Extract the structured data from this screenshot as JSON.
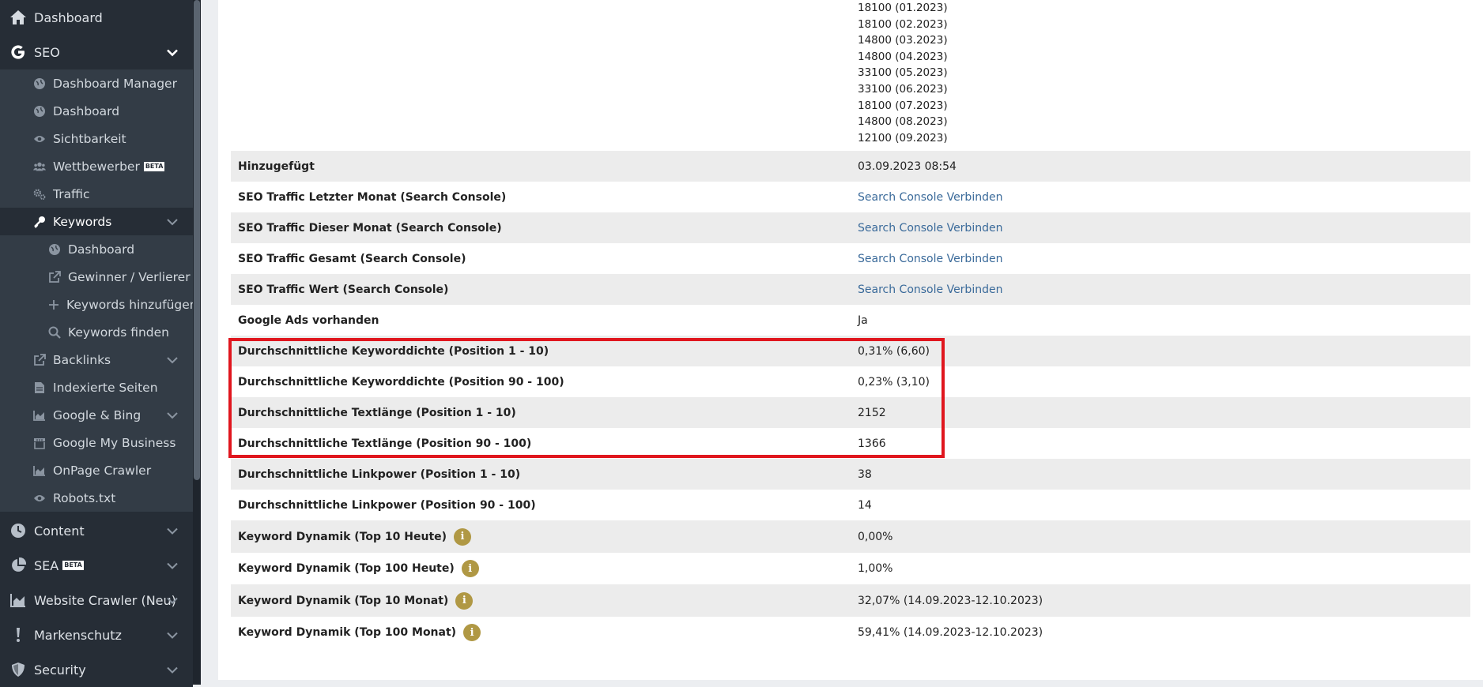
{
  "sidebar": {
    "dashboard": "Dashboard",
    "seo": "SEO",
    "seo_items": {
      "dashboard_manager": "Dashboard Manager",
      "dashboard": "Dashboard",
      "sichtbarkeit": "Sichtbarkeit",
      "wettbewerber": "Wettbewerber",
      "wettbewerber_badge": "BETA",
      "traffic": "Traffic",
      "keywords": "Keywords",
      "keywords_sub": {
        "dashboard": "Dashboard",
        "gewinner": "Gewinner / Verlierer",
        "hinzufuegen": "Keywords hinzufügen",
        "finden": "Keywords finden"
      },
      "backlinks": "Backlinks",
      "indexierte": "Indexierte Seiten",
      "google_bing": "Google & Bing",
      "gmb": "Google My Business",
      "onpage": "OnPage Crawler",
      "robots": "Robots.txt"
    },
    "content": "Content",
    "sea": "SEA",
    "sea_badge": "BETA",
    "website_crawler": "Website Crawler (Neu)",
    "markenschutz": "Markenschutz",
    "security": "Security"
  },
  "volumes": [
    "18100 (01.2023)",
    "18100 (02.2023)",
    "14800 (03.2023)",
    "14800 (04.2023)",
    "33100 (05.2023)",
    "33100 (06.2023)",
    "18100 (07.2023)",
    "14800 (08.2023)",
    "12100 (09.2023)"
  ],
  "rows": [
    {
      "label": "Hinzugefügt",
      "value": "03.09.2023 08:54"
    },
    {
      "label": "SEO Traffic Letzter Monat (Search Console)",
      "value": "Search Console Verbinden"
    },
    {
      "label": "SEO Traffic Dieser Monat (Search Console)",
      "value": "Search Console Verbinden"
    },
    {
      "label": "SEO Traffic Gesamt (Search Console)",
      "value": "Search Console Verbinden"
    },
    {
      "label": "SEO Traffic Wert (Search Console)",
      "value": "Search Console Verbinden"
    },
    {
      "label": "Google Ads vorhanden",
      "value": "Ja"
    },
    {
      "label": "Durchschnittliche Keyworddichte (Position 1 - 10)",
      "value": "0,31% (6,60)"
    },
    {
      "label": "Durchschnittliche Keyworddichte (Position 90 - 100)",
      "value": "0,23% (3,10)"
    },
    {
      "label": "Durchschnittliche Textlänge (Position 1 - 10)",
      "value": "2152"
    },
    {
      "label": "Durchschnittliche Textlänge (Position 90 - 100)",
      "value": "1366"
    },
    {
      "label": "Durchschnittliche Linkpower (Position 1 - 10)",
      "value": "38"
    },
    {
      "label": "Durchschnittliche Linkpower (Position 90 - 100)",
      "value": "14"
    },
    {
      "label": "Keyword Dynamik (Top 10 Heute)",
      "value": "0,00%"
    },
    {
      "label": "Keyword Dynamik (Top 100 Heute)",
      "value": "1,00%"
    },
    {
      "label": "Keyword Dynamik (Top 10 Monat)",
      "value": "32,07% (14.09.2023-12.10.2023)"
    },
    {
      "label": "Keyword Dynamik (Top 100 Monat)",
      "value": "59,41% (14.09.2023-12.10.2023)"
    }
  ],
  "info_glyph": "i",
  "colors": {
    "sidebar": "#262d36",
    "link": "#3a6a9a",
    "highlight": "#e0161e",
    "info": "#b09844"
  }
}
